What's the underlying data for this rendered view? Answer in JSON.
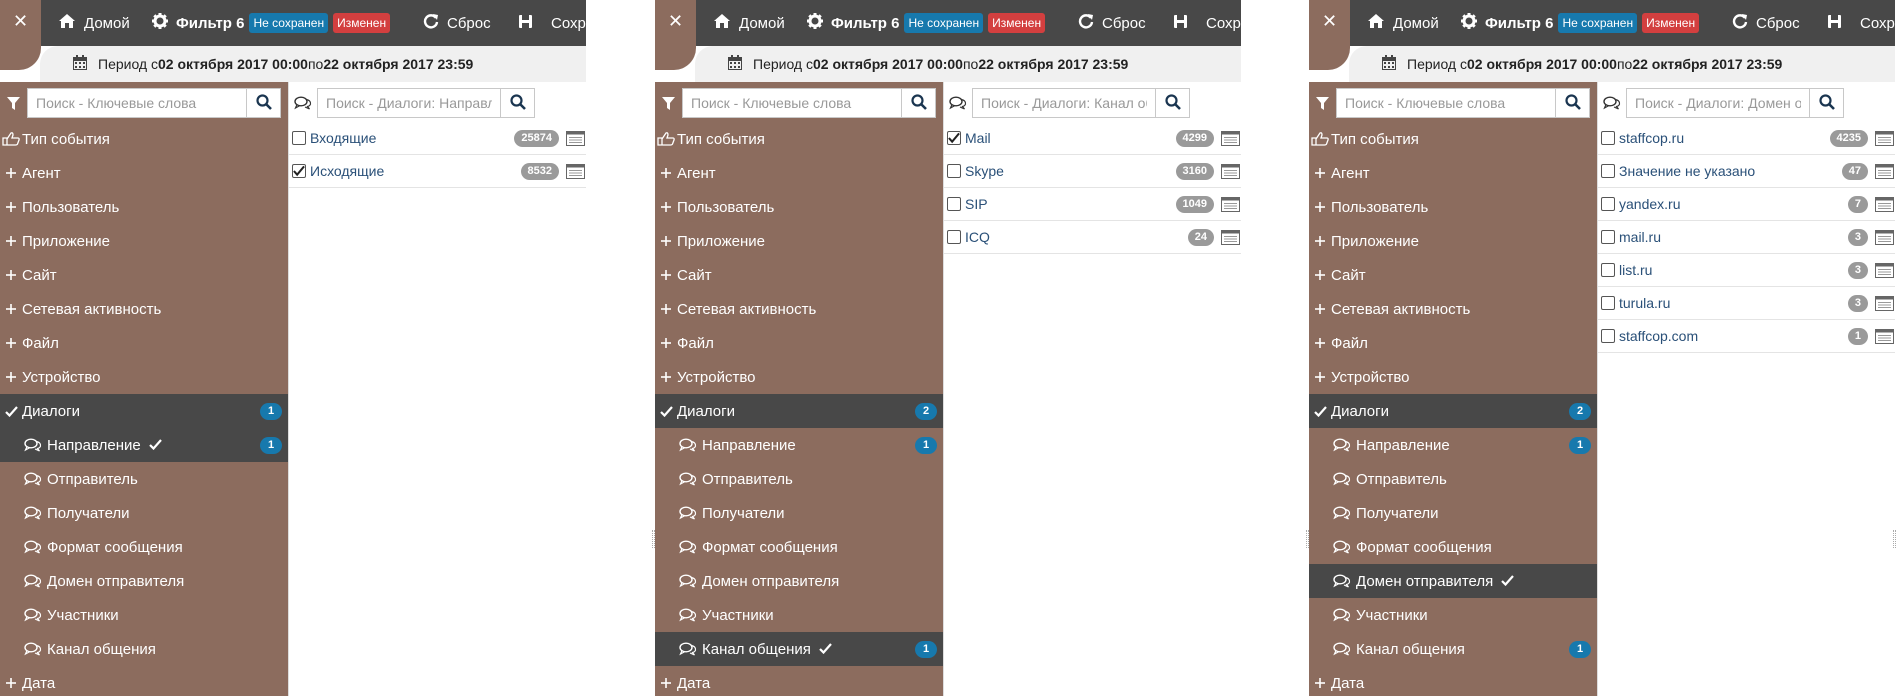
{
  "colors": {
    "topbar": "#484848",
    "sidebar": "#8c6c5e",
    "active": "#484848",
    "badge_blue": "#1779ad",
    "badge_red": "#d33f3f",
    "count_grey": "#9a9a9a"
  },
  "toolbar": {
    "home_label": "Домой",
    "filter_label": "Фильтр 6",
    "not_saved_badge": "Не сохранен",
    "changed_badge": "Изменен",
    "reset_label": "Сброс",
    "save_label": "Сохра",
    "close_glyph": "✕"
  },
  "period": {
    "prefix": "Период с",
    "from": "02 октября 2017 00:00",
    "middle": "по",
    "to": "22 октября 2017 23:59"
  },
  "sidebar": {
    "search_placeholder": "Поиск - Ключевые слова",
    "event_type_label": "Тип события",
    "top_items": [
      "Агент",
      "Пользователь",
      "Приложение",
      "Сайт",
      "Сетевая активность",
      "Файл",
      "Устройство"
    ],
    "dialogs_label": "Диалоги",
    "sub_items": [
      "Направление",
      "Отправитель",
      "Получатели",
      "Формат сообщения",
      "Домен отправителя",
      "Участники",
      "Канал общения"
    ],
    "date_label": "Дата"
  },
  "panels": [
    {
      "dialogs_count": "1",
      "active_sub": 0,
      "sub_counts": [
        "1",
        "",
        "",
        "",
        "",
        "",
        ""
      ],
      "content_search_placeholder": "Поиск - Диалоги: Направление",
      "items": [
        {
          "label": "Входящие",
          "count": "25874",
          "checked": false
        },
        {
          "label": "Исходящие",
          "count": "8532",
          "checked": true
        }
      ]
    },
    {
      "dialogs_count": "2",
      "active_sub": 6,
      "sub_counts": [
        "1",
        "",
        "",
        "",
        "",
        "",
        "1"
      ],
      "content_search_placeholder": "Поиск - Диалоги: Канал общения",
      "items": [
        {
          "label": "Mail",
          "count": "4299",
          "checked": true
        },
        {
          "label": "Skype",
          "count": "3160",
          "checked": false
        },
        {
          "label": "SIP",
          "count": "1049",
          "checked": false
        },
        {
          "label": "ICQ",
          "count": "24",
          "checked": false
        }
      ]
    },
    {
      "dialogs_count": "2",
      "active_sub": 4,
      "sub_counts": [
        "1",
        "",
        "",
        "",
        "",
        "",
        "1"
      ],
      "content_search_placeholder": "Поиск - Диалоги: Домен отправителя",
      "items": [
        {
          "label": "staffcop.ru",
          "count": "4235",
          "checked": false
        },
        {
          "label": "Значение не указано",
          "count": "47",
          "checked": false
        },
        {
          "label": "yandex.ru",
          "count": "7",
          "checked": false
        },
        {
          "label": "mail.ru",
          "count": "3",
          "checked": false
        },
        {
          "label": "list.ru",
          "count": "3",
          "checked": false
        },
        {
          "label": "turula.ru",
          "count": "3",
          "checked": false
        },
        {
          "label": "staffcop.com",
          "count": "1",
          "checked": false
        }
      ]
    }
  ]
}
